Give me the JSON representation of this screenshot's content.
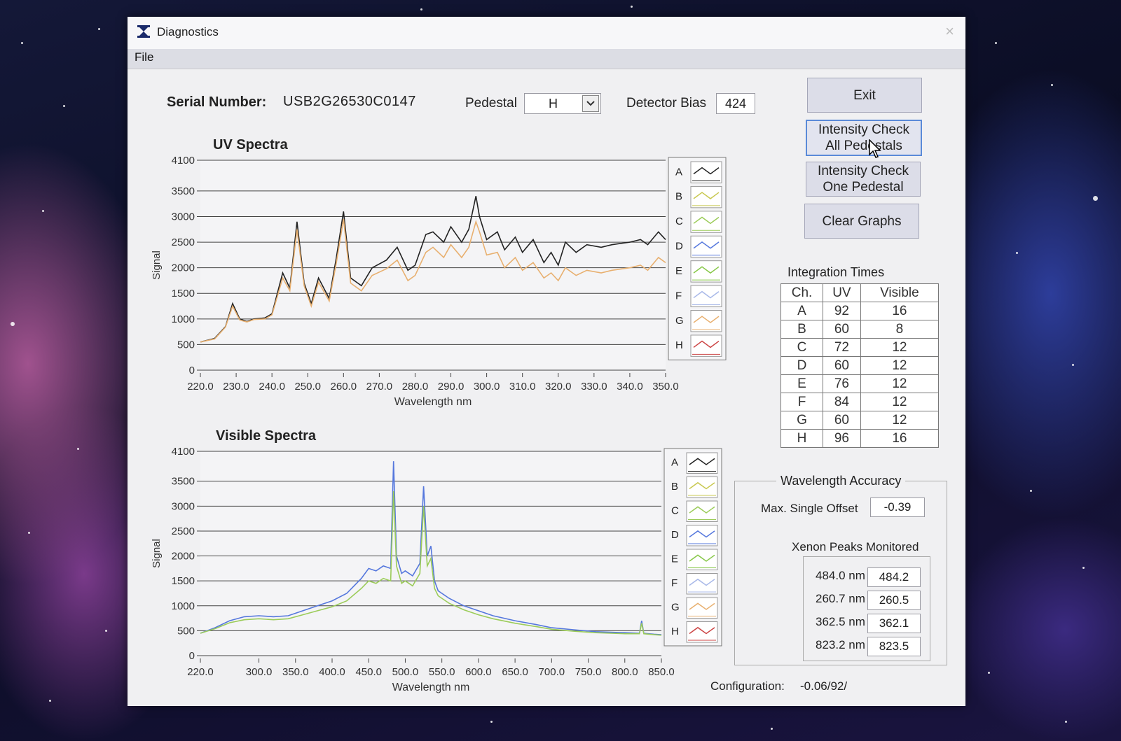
{
  "window": {
    "title": "Diagnostics",
    "close_glyph": "×"
  },
  "menu": {
    "file": "File"
  },
  "header": {
    "serial_label": "Serial Number:",
    "serial_value": "USB2G26530C0147",
    "pedestal_label": "Pedestal",
    "pedestal_value": "H",
    "bias_label": "Detector Bias",
    "bias_value": "424"
  },
  "buttons": {
    "exit": "Exit",
    "check_all_1": "Intensity Check",
    "check_all_2": "All Pedestals",
    "check_one_1": "Intensity Check",
    "check_one_2": "One Pedestal",
    "clear": "Clear Graphs"
  },
  "integration": {
    "title": "Integration Times",
    "headers": [
      "Ch.",
      "UV",
      "Visible"
    ],
    "rows": [
      [
        "A",
        "92",
        "16"
      ],
      [
        "B",
        "60",
        "8"
      ],
      [
        "C",
        "72",
        "12"
      ],
      [
        "D",
        "60",
        "12"
      ],
      [
        "E",
        "76",
        "12"
      ],
      [
        "F",
        "84",
        "12"
      ],
      [
        "G",
        "60",
        "12"
      ],
      [
        "H",
        "96",
        "16"
      ]
    ]
  },
  "accuracy": {
    "title": "Wavelength Accuracy",
    "max_label": "Max. Single Offset",
    "max_value": "-0.39",
    "xenon_title": "Xenon Peaks Monitored",
    "peaks": [
      {
        "label": "484.0 nm",
        "value": "484.2"
      },
      {
        "label": "260.7 nm",
        "value": "260.5"
      },
      {
        "label": "362.5 nm",
        "value": "362.1"
      },
      {
        "label": "823.2 nm",
        "value": "823.5"
      }
    ]
  },
  "config": {
    "label": "Configuration:",
    "value": "-0.06/92/"
  },
  "colors": {
    "A": "#222222",
    "B": "#c8c850",
    "C": "#9ccc5a",
    "D": "#5577dd",
    "E": "#88c84a",
    "F": "#a8b8e8",
    "G": "#e8b070",
    "H": "#cc4444"
  },
  "icons": [
    "app-icon",
    "close-icon",
    "chevron-down-icon",
    "mouse-cursor-icon"
  ],
  "chart_data": [
    {
      "type": "line",
      "title": "UV Spectra",
      "xlabel": "Wavelength nm",
      "ylabel": "Signal",
      "xlim": [
        220,
        350
      ],
      "ylim": [
        0,
        4100
      ],
      "xticks": [
        "220.0",
        "230.0",
        "240.0",
        "250.0",
        "260.0",
        "270.0",
        "280.0",
        "290.0",
        "300.0",
        "310.0",
        "320.0",
        "330.0",
        "340.0",
        "350.0"
      ],
      "yticks": [
        "0",
        "500",
        "1000",
        "1500",
        "2000",
        "2500",
        "3000",
        "3500",
        "4100"
      ],
      "legend": [
        "A",
        "B",
        "C",
        "D",
        "E",
        "F",
        "G",
        "H"
      ],
      "grid": true,
      "legend_position": "right",
      "series": [
        {
          "name": "A",
          "x": [
            220,
            224,
            227,
            229,
            231,
            233,
            235,
            238,
            240,
            243,
            245,
            247,
            249,
            251,
            253,
            256,
            258,
            260,
            262,
            265,
            268,
            272,
            275,
            278,
            280,
            283,
            285,
            288,
            290,
            293,
            295,
            297,
            298,
            300,
            303,
            305,
            308,
            310,
            313,
            316,
            318,
            320,
            322,
            325,
            328,
            332,
            335,
            340,
            343,
            345,
            348,
            350
          ],
          "y": [
            550,
            620,
            850,
            1300,
            1000,
            950,
            1000,
            1020,
            1100,
            1900,
            1600,
            2900,
            1700,
            1300,
            1800,
            1400,
            2200,
            3100,
            1800,
            1650,
            2000,
            2150,
            2400,
            1950,
            2050,
            2650,
            2700,
            2500,
            2800,
            2500,
            2750,
            3400,
            3000,
            2550,
            2700,
            2350,
            2600,
            2300,
            2550,
            2100,
            2300,
            2050,
            2500,
            2300,
            2450,
            2400,
            2450,
            2500,
            2550,
            2450,
            2700,
            2550
          ]
        },
        {
          "name": "G",
          "x": [
            220,
            224,
            227,
            229,
            231,
            233,
            235,
            238,
            240,
            243,
            245,
            247,
            249,
            251,
            253,
            256,
            258,
            260,
            262,
            265,
            268,
            272,
            275,
            278,
            280,
            283,
            285,
            288,
            290,
            293,
            295,
            297,
            298,
            300,
            303,
            305,
            308,
            310,
            313,
            316,
            318,
            320,
            322,
            325,
            328,
            332,
            335,
            340,
            343,
            345,
            348,
            350
          ],
          "y": [
            550,
            610,
            840,
            1250,
            980,
            940,
            990,
            1000,
            1080,
            1800,
            1550,
            2750,
            1650,
            1250,
            1720,
            1350,
            2100,
            2950,
            1700,
            1550,
            1850,
            1980,
            2150,
            1750,
            1850,
            2300,
            2400,
            2200,
            2450,
            2200,
            2400,
            2900,
            2700,
            2250,
            2300,
            2000,
            2200,
            1950,
            2100,
            1800,
            1900,
            1750,
            2000,
            1850,
            1950,
            1900,
            1950,
            2000,
            2050,
            1950,
            2200,
            2100
          ]
        }
      ]
    },
    {
      "type": "line",
      "title": "Visible Spectra",
      "xlabel": "Wavelength nm",
      "ylabel": "Signal",
      "xlim": [
        220,
        850
      ],
      "ylim": [
        0,
        4100
      ],
      "xticks": [
        "220.0",
        "300.0",
        "350.0",
        "400.0",
        "450.0",
        "500.0",
        "550.0",
        "600.0",
        "650.0",
        "700.0",
        "750.0",
        "800.0",
        "850.0"
      ],
      "yticks": [
        "0",
        "500",
        "1000",
        "1500",
        "2000",
        "2500",
        "3000",
        "3500",
        "4100"
      ],
      "legend": [
        "A",
        "B",
        "C",
        "D",
        "E",
        "F",
        "G",
        "H"
      ],
      "grid": true,
      "legend_position": "right",
      "series": [
        {
          "name": "D",
          "x": [
            220,
            240,
            260,
            280,
            300,
            320,
            340,
            360,
            380,
            400,
            420,
            440,
            450,
            460,
            470,
            480,
            484,
            488,
            495,
            500,
            510,
            520,
            525,
            530,
            535,
            540,
            545,
            550,
            560,
            580,
            600,
            620,
            650,
            680,
            700,
            730,
            760,
            800,
            820,
            823,
            826,
            840,
            850
          ],
          "y": [
            450,
            560,
            700,
            780,
            800,
            780,
            800,
            900,
            1000,
            1100,
            1250,
            1550,
            1750,
            1700,
            1800,
            1750,
            3900,
            2000,
            1650,
            1700,
            1600,
            1850,
            3400,
            2000,
            2200,
            1500,
            1300,
            1250,
            1150,
            1000,
            900,
            800,
            700,
            620,
            560,
            520,
            480,
            460,
            450,
            700,
            450,
            430,
            420
          ]
        },
        {
          "name": "C",
          "x": [
            220,
            240,
            260,
            280,
            300,
            320,
            340,
            360,
            380,
            400,
            420,
            440,
            450,
            460,
            470,
            480,
            484,
            488,
            495,
            500,
            510,
            520,
            525,
            530,
            535,
            540,
            545,
            550,
            560,
            580,
            600,
            620,
            650,
            680,
            700,
            730,
            760,
            800,
            820,
            823,
            826,
            840,
            850
          ],
          "y": [
            450,
            540,
            660,
            720,
            740,
            720,
            740,
            820,
            900,
            980,
            1100,
            1350,
            1500,
            1450,
            1550,
            1500,
            3300,
            1800,
            1450,
            1500,
            1400,
            1650,
            3000,
            1800,
            1950,
            1350,
            1200,
            1150,
            1050,
            920,
            820,
            740,
            650,
            580,
            530,
            490,
            460,
            440,
            440,
            650,
            440,
            420,
            410
          ]
        }
      ]
    }
  ]
}
